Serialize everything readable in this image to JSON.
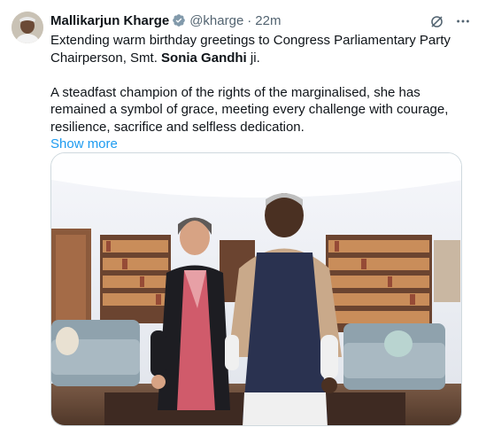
{
  "author": {
    "name": "Mallikarjun Kharge",
    "handle": "@kharge",
    "time": "22m",
    "verified": true
  },
  "icons": {
    "verified": "verified-badge-icon",
    "grok": "grok-icon",
    "more": "more-icon"
  },
  "tweet": {
    "line1_a": "Extending warm birthday greetings to Congress Parliamentary Party",
    "line2_a": "Chairperson, Smt. ",
    "line2_bold": "Sonia Gandhi",
    "line2_b": " ji.",
    "para2": "A steadfast champion of the rights of the marginalised, she has remained a symbol of grace, meeting every challenge with courage, resilience, sacrifice and selfless dedication.",
    "show_more": "Show more"
  },
  "colors": {
    "link": "#1d9bf0",
    "verified": "#829aab",
    "secondary_text": "#536471"
  }
}
